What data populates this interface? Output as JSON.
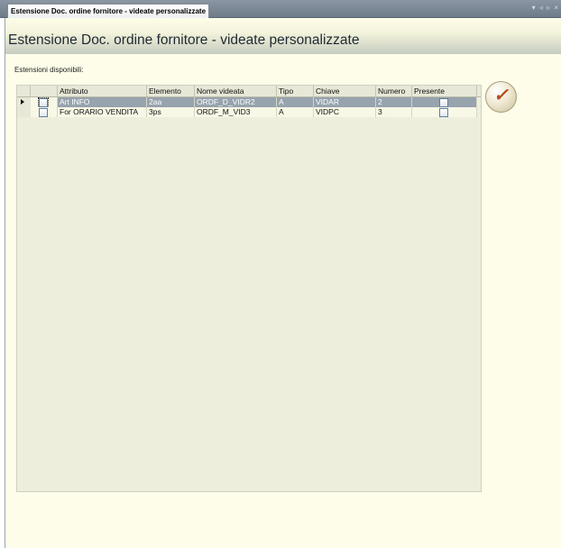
{
  "tab": {
    "label": "Estensione Doc. ordine fornitore - videate personalizzate",
    "controls": "▾ ◃ ▹ ×"
  },
  "page": {
    "title": "Estensione Doc. ordine fornitore - videate personalizzate"
  },
  "extensions": {
    "caption": "Estensioni disponibili:"
  },
  "grid": {
    "columns": [
      "Attributo",
      "Elemento",
      "Nome videata",
      "Tipo",
      "Chiave",
      "Numero",
      "Presente"
    ],
    "rows": [
      {
        "attributo": "Art INFO",
        "elemento": "2aa",
        "nome_videata": "ORDF_D_VIDR2",
        "tipo": "A",
        "chiave": "VIDAR",
        "numero": "2",
        "presente": false,
        "selected": true
      },
      {
        "attributo": "For ORARIO VENDITA",
        "elemento": "3ps",
        "nome_videata": "ORDF_M_VID3",
        "tipo": "A",
        "chiave": "VIDPC",
        "numero": "3",
        "presente": false,
        "selected": false
      }
    ]
  },
  "confirm_button": {
    "glyph": "✓",
    "icon": "checkmark-icon"
  }
}
